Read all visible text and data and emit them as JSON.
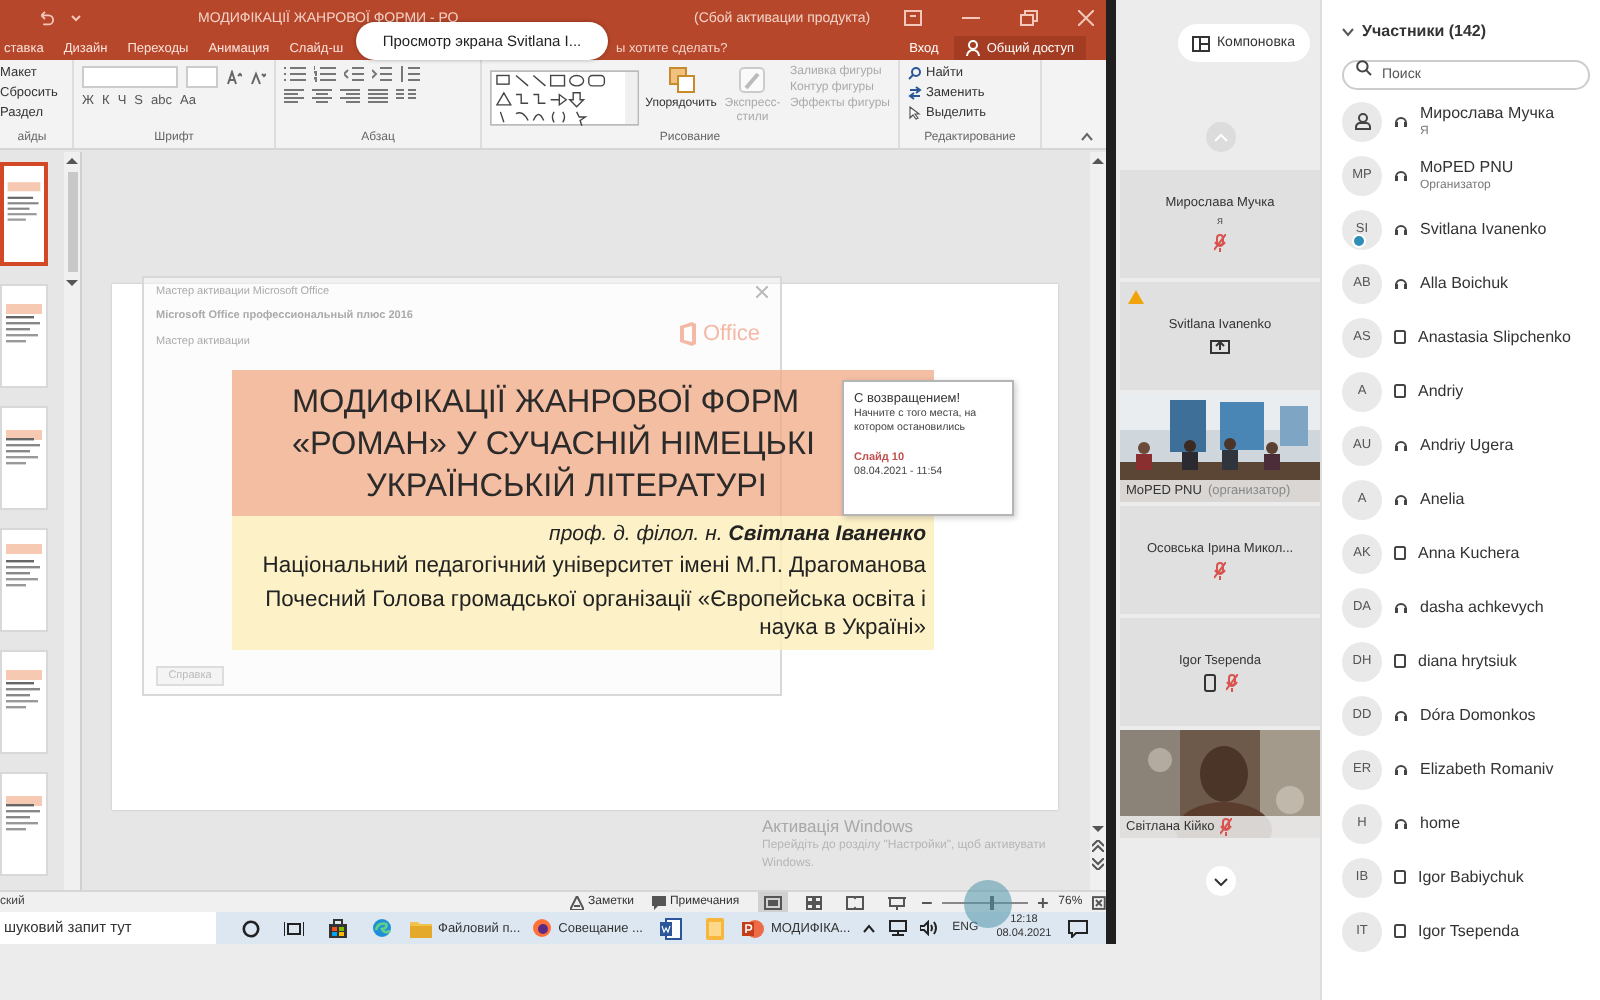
{
  "share_banner": "Просмотр экрана Svitlana I...",
  "powerpoint": {
    "title": "МОДИФІКАЦІЇ ЖАНРОВОЇ ФОРМИ - РО",
    "title_suffix": "(Сбой активации продукта)",
    "tabs": [
      {
        "label": "ставка",
        "selected": false
      },
      {
        "label": "Дизайн",
        "selected": false
      },
      {
        "label": "Переходы",
        "selected": false
      },
      {
        "label": "Анимация",
        "selected": false
      },
      {
        "label": "Слайд-ш",
        "selected": false
      }
    ],
    "tell_me": "ы хотите сделать?",
    "sign_in": "Вход",
    "share": "Общий доступ",
    "ribbon_groups": [
      {
        "kind": "slides",
        "label": "айды",
        "buttons": [
          "Макет",
          "Сбросить",
          "Раздел"
        ]
      },
      {
        "kind": "font",
        "label": "Шрифт",
        "buttons": [
          "Ж",
          "К",
          "Ч",
          "S",
          "abc",
          "Aa"
        ]
      },
      {
        "kind": "paragraph",
        "label": "Абзац"
      },
      {
        "kind": "drawing",
        "label": "Рисование",
        "buttons": [
          "Упорядочить",
          "Экспресс-стили"
        ],
        "shape_buttons": [
          "Заливка фигуры",
          "Контур фигуры",
          "Эффекты фигуры"
        ]
      },
      {
        "kind": "editing",
        "label": "Редактирование",
        "buttons": [
          "Найти",
          "Заменить",
          "Выделить"
        ]
      }
    ]
  },
  "slide_thumbnails": [
    {
      "selected": true
    },
    {
      "selected": false
    },
    {
      "selected": false
    },
    {
      "selected": false
    },
    {
      "selected": false
    },
    {
      "selected": false
    }
  ],
  "slide": {
    "title_lines": [
      "МОДИФІКАЦІЇ ЖАНРОВОЇ ФОРМ",
      "«РОМАН» У СУЧАСНІЙ НІМЕЦЬКІ",
      "УКРАЇНСЬКІЙ ЛІТЕРАТУРІ"
    ],
    "author": "проф. д. філол. н. **Світлана Іваненко**",
    "affiliation": "Національний педагогічний університет імені М.П. Драгоманова",
    "honor": "Почесний Голова громадської організації «Європейська освіта і наука в Україні»"
  },
  "activation_dialog": {
    "title": "Мастер активации Microsoft Office",
    "product": "Microsoft Office профессиональный плюс 2016",
    "subtitle": "Мастер активации",
    "logo": "Office",
    "help_button": "Справка"
  },
  "resume_tooltip": {
    "heading": "С возвращением!",
    "text": "Начните с того места, на котором остановились",
    "slide": "Слайд 10",
    "date": "08.04.2021 - 11:54"
  },
  "windows_activation": {
    "title": "Активація Windows",
    "text": "Перейдіть до розділу \"Настройки\", щоб активувати Windows."
  },
  "status_bar": {
    "language": "ский",
    "notes": "Заметки",
    "comments": "Примечания",
    "views": [
      {
        "kind": "normal",
        "selected": true
      },
      {
        "kind": "sorter",
        "selected": false
      },
      {
        "kind": "reading",
        "selected": false
      },
      {
        "kind": "slideshow",
        "selected": false
      }
    ],
    "zoom_slider": {
      "level": 0.55
    },
    "zoom": "76%"
  },
  "taskbar": {
    "search": "шуковий запит тут",
    "apps": [
      {
        "kind": "cortana"
      },
      {
        "kind": "taskview"
      },
      {
        "kind": "store"
      },
      {
        "kind": "edge"
      },
      {
        "kind": "explorer",
        "label": "Файловий п..."
      },
      {
        "kind": "firefox",
        "label": "Совещание ..."
      },
      {
        "kind": "word"
      },
      {
        "kind": "notes"
      },
      {
        "kind": "powerpoint",
        "label": "МОДИФІКА..."
      }
    ],
    "language": "ENG",
    "time": "12:18",
    "date": "08.04.2021"
  },
  "meeting": {
    "layout_button": "Компоновка",
    "tiles": [
      {
        "kind": "empty",
        "name": "Мирослава Мучка",
        "role": "я",
        "muted": true,
        "phone": false,
        "sharing": false,
        "warning": false
      },
      {
        "kind": "empty",
        "name": "Svitlana Ivanenko",
        "muted": false,
        "phone": false,
        "sharing": true,
        "warning": true
      },
      {
        "kind": "video",
        "name": "MoPED PNU",
        "role": "(организатор)",
        "muted": false,
        "phone": false,
        "sharing": false,
        "warning": false
      },
      {
        "kind": "empty",
        "name": "Осовська Ірина Микол...",
        "muted": true,
        "phone": false,
        "sharing": false,
        "warning": false
      },
      {
        "kind": "empty",
        "name": "Igor Tsependa",
        "muted": true,
        "phone": true,
        "sharing": false,
        "warning": false
      },
      {
        "kind": "video",
        "name": "Світлана Кійко",
        "muted": true,
        "phone": false,
        "sharing": false,
        "warning": false
      }
    ]
  },
  "participants": {
    "header": "Участники (142)",
    "expanded": true,
    "search_placeholder": "Поиск",
    "list": [
      {
        "name": "Мирослава Мучка",
        "role": "Я",
        "kind": "headset",
        "badge": false
      },
      {
        "initials": "MP",
        "name": "MoPED PNU",
        "role": "Организатор",
        "kind": "headset",
        "badge": false
      },
      {
        "initials": "SI",
        "name": "Svitlana Ivanenko",
        "kind": "headset",
        "badge": true
      },
      {
        "initials": "AB",
        "name": "Alla Boichuk",
        "kind": "headset",
        "badge": false
      },
      {
        "initials": "AS",
        "name": "Anastasia Slipchenko",
        "kind": "phone",
        "badge": false
      },
      {
        "initials": "A",
        "name": "Andriy",
        "kind": "phone",
        "badge": false
      },
      {
        "initials": "AU",
        "name": "Andriy Ugera",
        "kind": "headset",
        "badge": false
      },
      {
        "initials": "A",
        "name": "Anelia",
        "kind": "headset",
        "badge": false
      },
      {
        "initials": "AK",
        "name": "Anna Kuchera",
        "kind": "phone",
        "badge": false
      },
      {
        "initials": "DA",
        "name": "dasha achkevych",
        "kind": "headset",
        "badge": false
      },
      {
        "initials": "DH",
        "name": "diana hrytsiuk",
        "kind": "phone",
        "badge": false
      },
      {
        "initials": "DD",
        "name": "Dóra Domonkos",
        "kind": "headset",
        "badge": false
      },
      {
        "initials": "ER",
        "name": "Elizabeth Romaniv",
        "kind": "headset",
        "badge": false
      },
      {
        "initials": "H",
        "name": "home",
        "kind": "headset",
        "badge": false
      },
      {
        "initials": "IB",
        "name": "Igor Babiychuk",
        "kind": "phone",
        "badge": false
      },
      {
        "initials": "IT",
        "name": "Igor Tsependa",
        "kind": "phone",
        "badge": false
      }
    ]
  }
}
